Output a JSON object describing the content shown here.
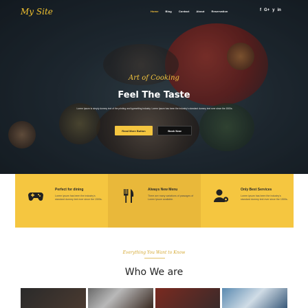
{
  "brand": {
    "logo": "My Site"
  },
  "nav": {
    "items": [
      {
        "label": "Home",
        "active": true
      },
      {
        "label": "Blog",
        "active": false
      },
      {
        "label": "Contact",
        "active": false
      },
      {
        "label": "About",
        "active": false
      },
      {
        "label": "Reservation",
        "active": false
      }
    ],
    "social": [
      "f",
      "G+",
      "y",
      "in"
    ]
  },
  "hero": {
    "subtitle": "Art of Cooking",
    "title": "Feel The Taste",
    "text": "Lorem Ipsum is simply dummy text of the printing and typesetting industry. Lorem Ipsum has been the industry's standard dummy text ever since the 1500s.",
    "read_more": "Read More Button",
    "book_now": "Book Now"
  },
  "features": [
    {
      "icon": "gamepad-icon",
      "title": "Perfect for dining",
      "text": "Lorem ipsum has been the industry's standard dummy text ever since the 1500s."
    },
    {
      "icon": "fork-knife-icon",
      "title": "Always New Menu",
      "text": "There are many variations of passages of Lorem Ipsum available."
    },
    {
      "icon": "user-gear-icon",
      "title": "Only Best Services",
      "text": "Lorem ipsum has been the industry's standard dummy text ever since the 1500s."
    }
  ],
  "about": {
    "script": "Everything You Want to Know",
    "title": "Who We are"
  },
  "colors": {
    "accent": "#f5c640",
    "accent_dark": "#e9b83a",
    "logo": "#f2c230"
  }
}
